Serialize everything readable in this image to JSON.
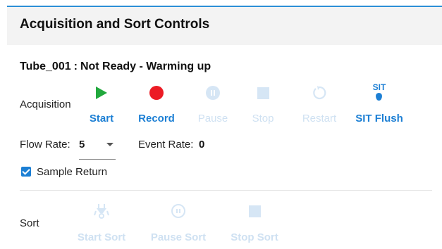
{
  "panel": {
    "title": "Acquisition and Sort Controls"
  },
  "status": {
    "tube": "Tube_001",
    "separator": ":",
    "state": "Not Ready - Warming up"
  },
  "acquisition": {
    "label": "Acquisition",
    "controls": [
      {
        "label": "Start",
        "icon": "play-icon",
        "enabled": true
      },
      {
        "label": "Record",
        "icon": "record-icon",
        "enabled": true
      },
      {
        "label": "Pause",
        "icon": "pause-icon",
        "enabled": false
      },
      {
        "label": "Stop",
        "icon": "stop-icon",
        "enabled": false
      },
      {
        "label": "Restart",
        "icon": "restart-icon",
        "enabled": false
      },
      {
        "label": "SIT Flush",
        "icon": "sit-flush-icon",
        "icon_text": "SIT",
        "enabled": true
      }
    ]
  },
  "flow_rate": {
    "label": "Flow Rate:",
    "value": "5"
  },
  "event_rate": {
    "label": "Event Rate:",
    "value": "0"
  },
  "sample_return": {
    "label": "Sample Return",
    "checked": true
  },
  "sort": {
    "label": "Sort",
    "controls": [
      {
        "label": "Start Sort",
        "icon": "sort-nozzle-icon",
        "enabled": false
      },
      {
        "label": "Pause Sort",
        "icon": "pause-icon",
        "enabled": false
      },
      {
        "label": "Stop Sort",
        "icon": "stop-icon",
        "enabled": false
      }
    ]
  },
  "colors": {
    "accent": "#1c7fd4",
    "play": "#21a83d",
    "record": "#ec1b24",
    "disabled": "#cfe1f2"
  }
}
